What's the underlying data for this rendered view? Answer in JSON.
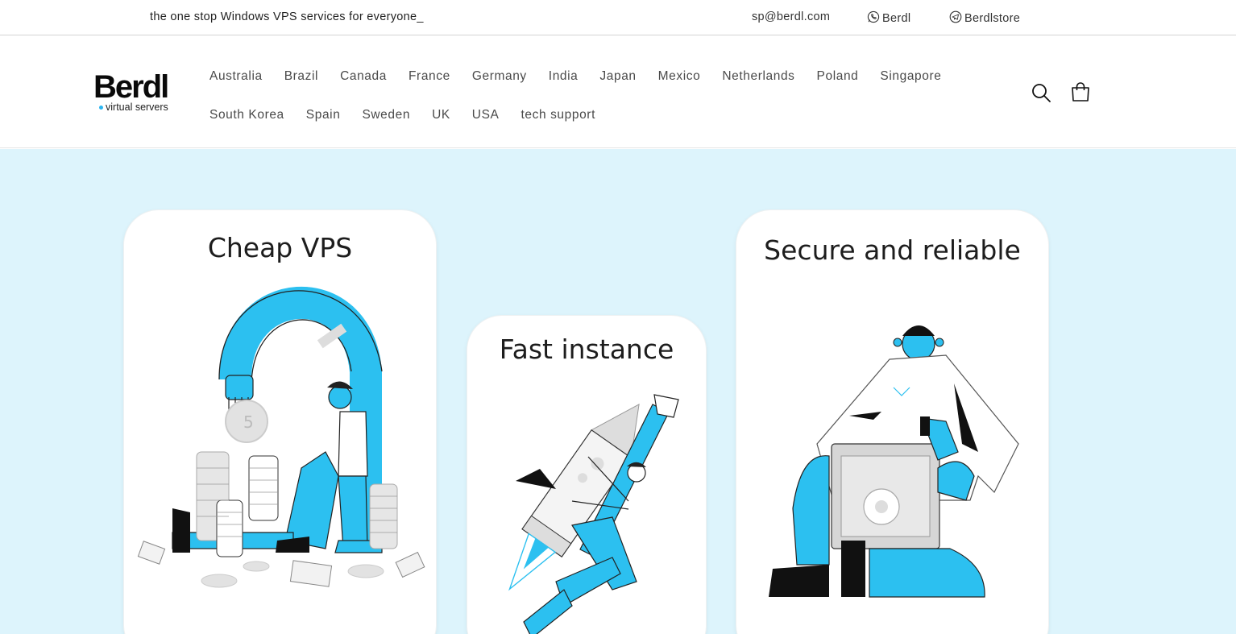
{
  "announcement": {
    "tagline": "the one stop Windows VPS services for everyone_",
    "email": "sp@berdl.com",
    "whatsapp": "Berdl",
    "telegram": "Berdlstore"
  },
  "header": {
    "logo_text": "Berdl",
    "logo_sub": "virtual servers",
    "nav_row1": [
      "Australia",
      "Brazil",
      "Canada",
      "France",
      "Germany",
      "India",
      "Japan",
      "Mexico",
      "Netherlands",
      "Poland",
      "Singapore"
    ],
    "nav_row2": [
      "South Korea",
      "Spain",
      "Sweden",
      "UK",
      "USA",
      "tech support"
    ]
  },
  "cards": {
    "cheap": "Cheap VPS",
    "fast": "Fast instance",
    "secure": "Secure and reliable"
  },
  "colors": {
    "accent_blue": "#2cc0f0",
    "hero_bg": "#ddf4fc",
    "logo_dot": "#2bb5f0"
  },
  "icons": [
    "whatsapp-icon",
    "telegram-icon",
    "search-icon",
    "cart-icon"
  ]
}
